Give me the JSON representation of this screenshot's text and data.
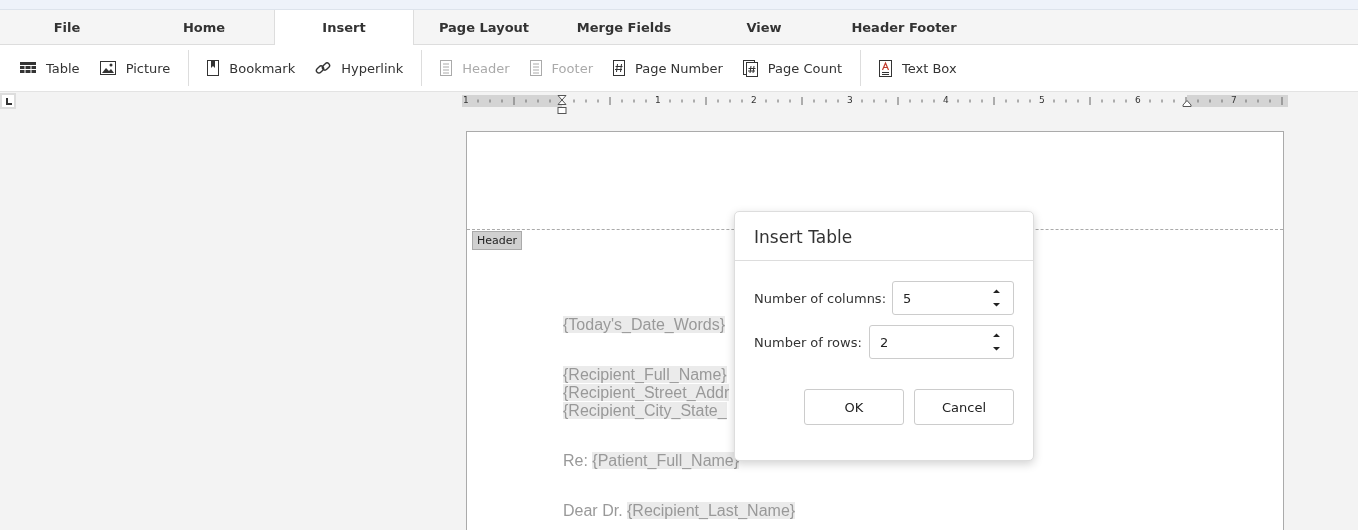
{
  "tabs": [
    {
      "label": "File",
      "selected": false
    },
    {
      "label": "Home",
      "selected": false
    },
    {
      "label": "Insert",
      "selected": true
    },
    {
      "label": "Page Layout",
      "selected": false
    },
    {
      "label": "Merge Fields",
      "selected": false
    },
    {
      "label": "View",
      "selected": false
    },
    {
      "label": "Header Footer",
      "selected": false
    }
  ],
  "toolbar": {
    "groups": [
      [
        {
          "label": "Table",
          "kind": "table",
          "disabled": false
        },
        {
          "label": "Picture",
          "kind": "picture",
          "disabled": false
        }
      ],
      [
        {
          "label": "Bookmark",
          "kind": "bookmark",
          "disabled": false
        },
        {
          "label": "Hyperlink",
          "kind": "link",
          "disabled": false
        }
      ],
      [
        {
          "label": "Header",
          "kind": "header",
          "disabled": true
        },
        {
          "label": "Footer",
          "kind": "footer",
          "disabled": true
        },
        {
          "label": "Page Number",
          "kind": "pagenum",
          "disabled": false
        },
        {
          "label": "Page Count",
          "kind": "pagecount",
          "disabled": false
        }
      ],
      [
        {
          "label": "Text Box",
          "kind": "textbox",
          "disabled": false
        }
      ]
    ]
  },
  "ruler": {
    "labels": [
      "1",
      "1",
      "2",
      "3",
      "4",
      "5",
      "6",
      "7"
    ]
  },
  "document": {
    "header_tag": "Header",
    "lines": [
      {
        "kind": "field",
        "parts": [
          {
            "text": "{Today's_Date_Words}",
            "field": true
          }
        ]
      },
      {
        "kind": "gap"
      },
      {
        "kind": "field",
        "parts": [
          {
            "text": "{Recipient_Full_Name}",
            "field": true
          }
        ]
      },
      {
        "kind": "field",
        "parts": [
          {
            "text": "{Recipient_Street_Addr",
            "field": true
          }
        ]
      },
      {
        "kind": "field",
        "parts": [
          {
            "text": "{Recipient_City_State_",
            "field": true
          }
        ]
      },
      {
        "kind": "gap"
      },
      {
        "kind": "field",
        "parts": [
          {
            "text": "Re: ",
            "field": false
          },
          {
            "text": "{Patient_Full_Name}",
            "field": true
          }
        ]
      },
      {
        "kind": "gap"
      },
      {
        "kind": "field",
        "parts": [
          {
            "text": "Dear Dr. ",
            "field": false
          },
          {
            "text": "{Recipient_Last_Name}",
            "field": true
          }
        ]
      }
    ]
  },
  "dialog": {
    "title": "Insert Table",
    "fields": [
      {
        "label": "Number of columns:",
        "value": "5"
      },
      {
        "label": "Number of rows:",
        "value": "2"
      }
    ],
    "buttons": [
      "OK",
      "Cancel"
    ]
  }
}
